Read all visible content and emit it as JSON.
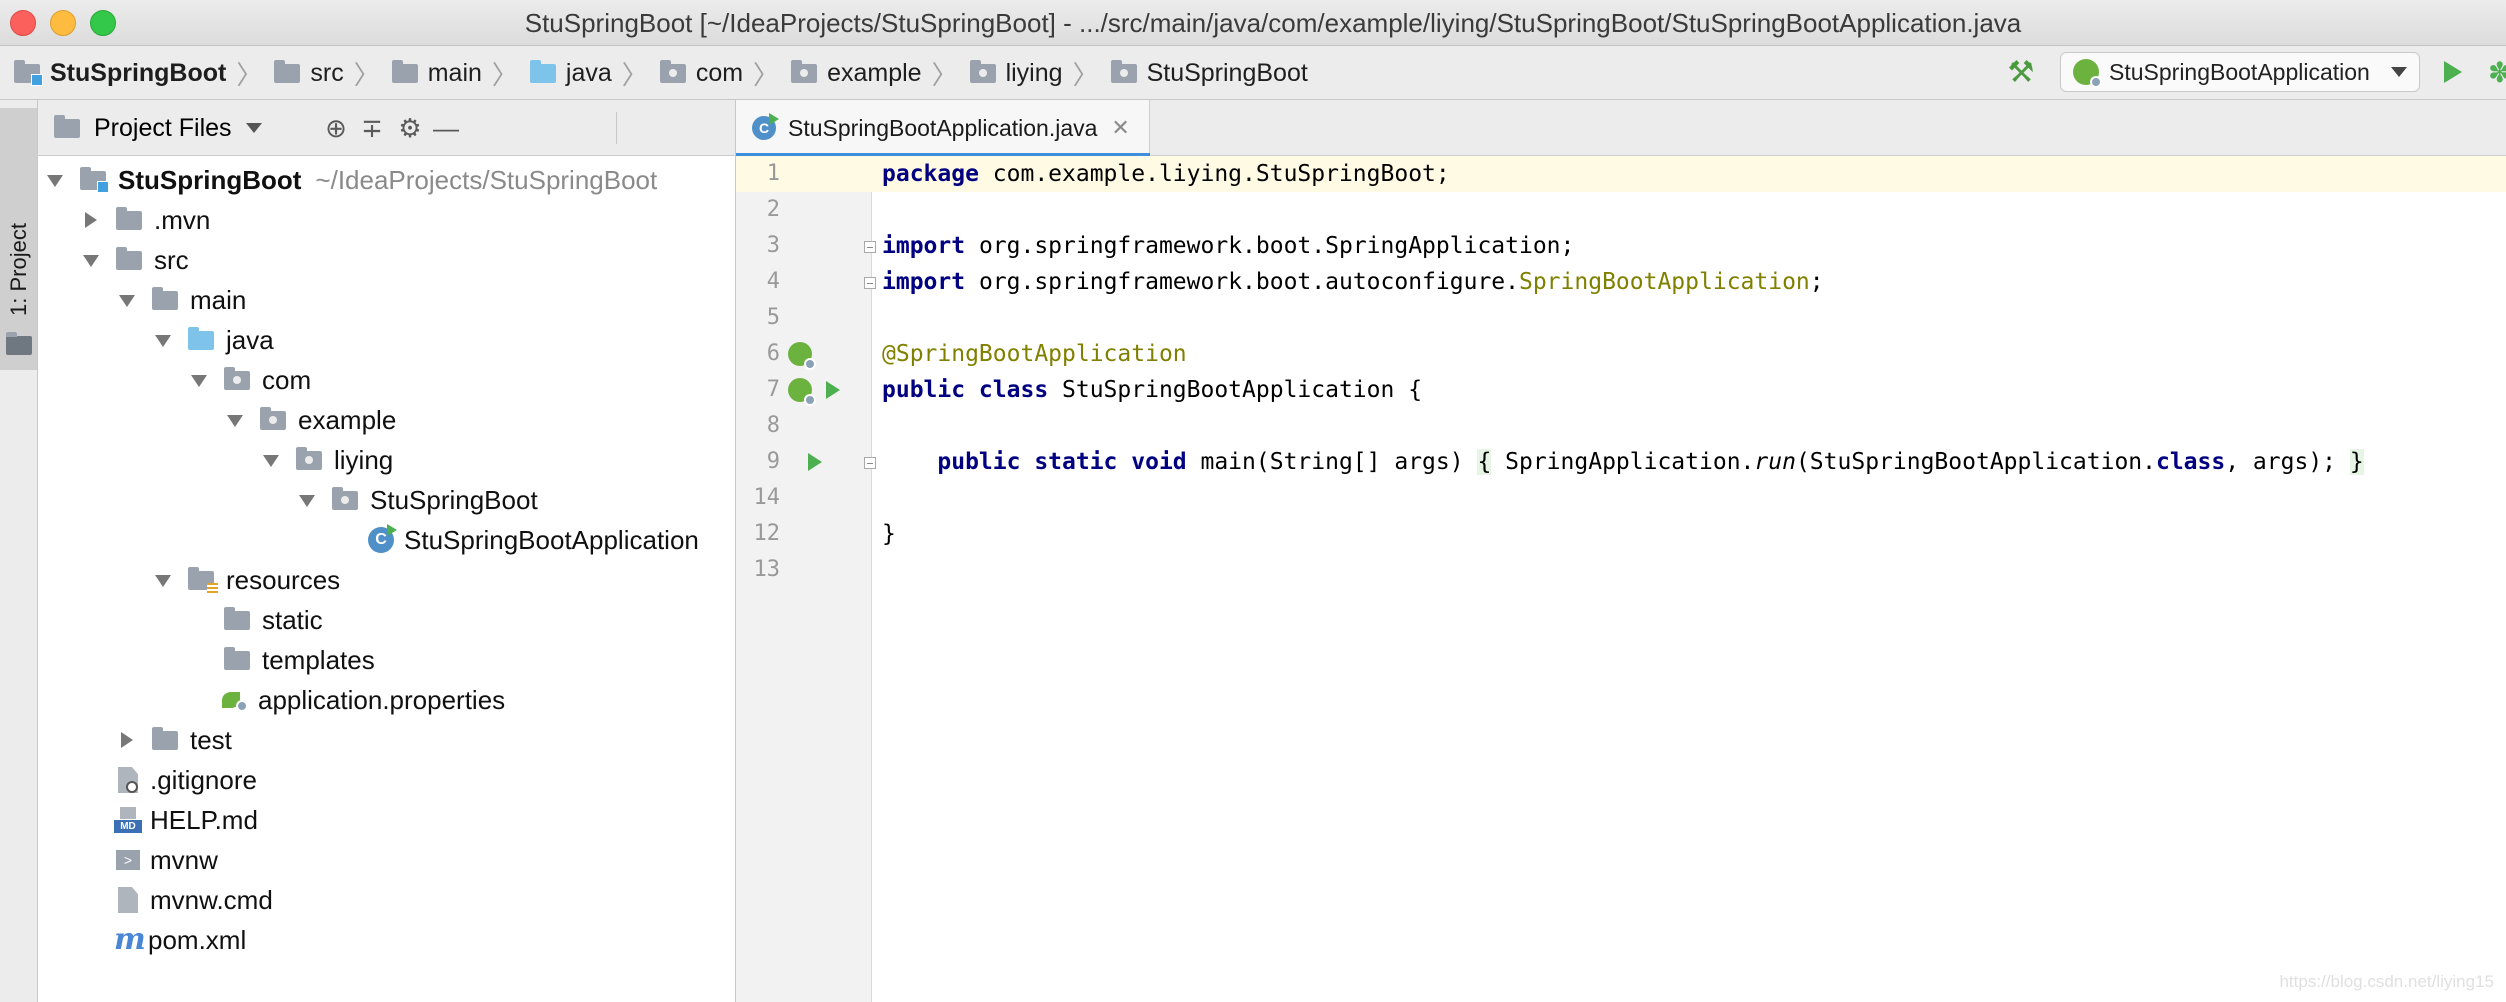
{
  "window": {
    "title": "StuSpringBoot [~/IdeaProjects/StuSpringBoot] - .../src/main/java/com/example/liying/StuSpringBoot/StuSpringBootApplication.java"
  },
  "breadcrumbs": [
    "StuSpringBoot",
    "src",
    "main",
    "java",
    "com",
    "example",
    "liying",
    "StuSpringBoot"
  ],
  "toolbar": {
    "build_icon": "hammer-icon",
    "run_config": "StuSpringBootApplication",
    "run_icon": "run-icon",
    "debug_icon": "debug-icon"
  },
  "tool_strip": {
    "project_tab": "1: Project"
  },
  "project_panel": {
    "title": "Project Files",
    "icons": [
      "locate-icon",
      "collapse-all-icon",
      "gear-icon",
      "hide-icon"
    ],
    "tree": [
      {
        "name": "StuSpringBoot",
        "path": "~/IdeaProjects/StuSpringBoot",
        "level": 0,
        "state": "open",
        "icon": "module-folder-icon"
      },
      {
        "name": ".mvn",
        "level": 1,
        "state": "closed",
        "icon": "folder-icon"
      },
      {
        "name": "src",
        "level": 1,
        "state": "open",
        "icon": "folder-icon"
      },
      {
        "name": "main",
        "level": 2,
        "state": "open",
        "icon": "folder-icon"
      },
      {
        "name": "java",
        "level": 3,
        "state": "open",
        "icon": "source-folder-icon"
      },
      {
        "name": "com",
        "level": 4,
        "state": "open",
        "icon": "package-icon"
      },
      {
        "name": "example",
        "level": 5,
        "state": "open",
        "icon": "package-icon"
      },
      {
        "name": "liying",
        "level": 6,
        "state": "open",
        "icon": "package-icon"
      },
      {
        "name": "StuSpringBoot",
        "level": 7,
        "state": "open",
        "icon": "package-icon"
      },
      {
        "name": "StuSpringBootApplication",
        "level": 8,
        "state": "leaf",
        "icon": "spring-class-icon"
      },
      {
        "name": "resources",
        "level": 3,
        "state": "open",
        "icon": "resources-folder-icon"
      },
      {
        "name": "static",
        "level": 4,
        "state": "leaf",
        "icon": "folder-icon"
      },
      {
        "name": "templates",
        "level": 4,
        "state": "leaf",
        "icon": "folder-icon"
      },
      {
        "name": "application.properties",
        "level": 4,
        "state": "leaf",
        "icon": "spring-properties-icon"
      },
      {
        "name": "test",
        "level": 2,
        "state": "closed",
        "icon": "folder-icon"
      },
      {
        "name": ".gitignore",
        "level": 1,
        "state": "leaf",
        "icon": "gitignore-icon"
      },
      {
        "name": "HELP.md",
        "level": 1,
        "state": "leaf",
        "icon": "markdown-icon"
      },
      {
        "name": "mvnw",
        "level": 1,
        "state": "leaf",
        "icon": "shell-icon"
      },
      {
        "name": "mvnw.cmd",
        "level": 1,
        "state": "leaf",
        "icon": "file-icon"
      },
      {
        "name": "pom.xml",
        "level": 1,
        "state": "leaf",
        "icon": "maven-icon"
      }
    ]
  },
  "editor": {
    "tab_label": "StuSpringBootApplication.java",
    "tab_close": "✕",
    "line_numbers": [
      "1",
      "2",
      "3",
      "4",
      "5",
      "6",
      "7",
      "8",
      "9",
      "12",
      "13",
      "14"
    ],
    "code": {
      "l1_kw": "package",
      "l1_rest": " com.example.liying.StuSpringBoot;",
      "l3_kw": "import",
      "l3_rest": " org.springframework.boot.SpringApplication;",
      "l4_kw": "import",
      "l4_rest": " org.springframework.boot.autoconfigure.",
      "l4_anno": "SpringBootApplication",
      "l4_end": ";",
      "l6_anno": "@SpringBootApplication",
      "l7_kw": "public class",
      "l7_rest": " StuSpringBootApplication {",
      "l9_indent": "    ",
      "l9_kw": "public static void",
      "l9_sig": " main(String[] args) ",
      "l9_open": "{",
      "l9_call": " SpringApplication.",
      "l9_run": "run",
      "l9_args": "(StuSpringBootApplication.",
      "l9_class": "class",
      "l9_tail": ", args); ",
      "l9_close": "}",
      "l13": "}"
    }
  },
  "watermark": "https://blog.csdn.net/liying15"
}
